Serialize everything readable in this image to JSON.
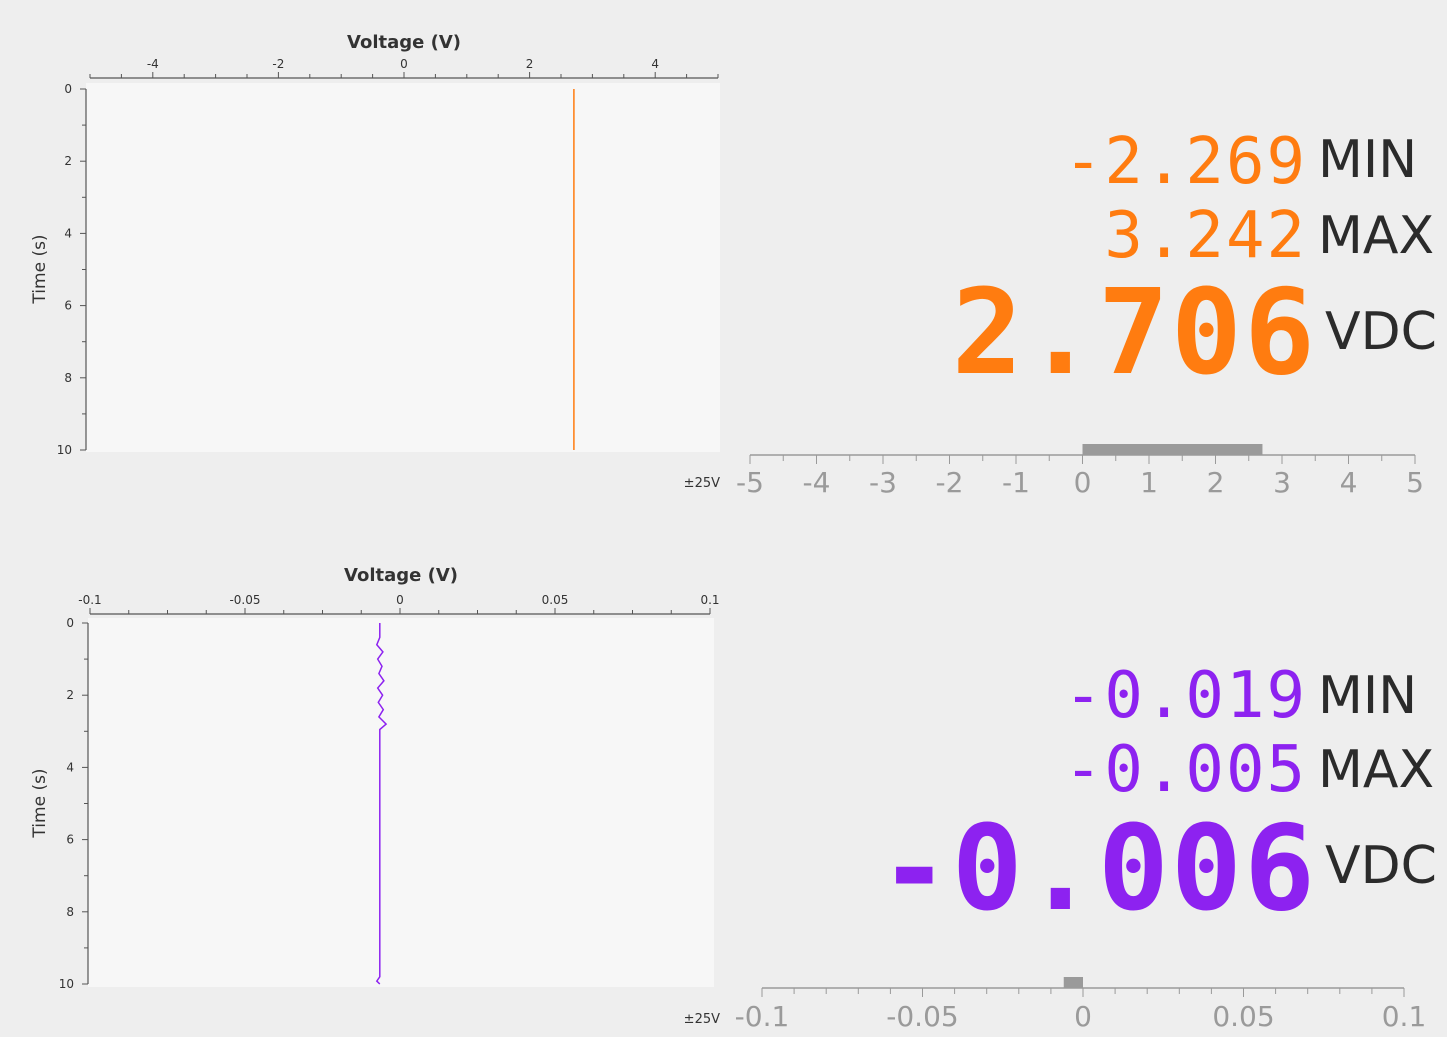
{
  "channels": [
    {
      "id": "ch1",
      "color": "#ff7c10",
      "plot": {
        "xlabel": "Voltage (V)",
        "ylabel": "Time (s)",
        "xlim": [
          -5,
          5
        ],
        "ylim": [
          0,
          10
        ],
        "x_ticks": [
          -4,
          -2,
          0,
          2,
          4
        ],
        "y_ticks": [
          0,
          2,
          4,
          6,
          8,
          10
        ],
        "trace": [
          [
            2.706,
            0
          ],
          [
            2.706,
            10
          ]
        ]
      },
      "readout": {
        "min_value": "-2.269",
        "min_label": "MIN",
        "max_value": "3.242",
        "max_label": "MAX",
        "value": "2.706",
        "unit": "VDC"
      },
      "bar": {
        "range_label": "±25V",
        "ticks": [
          "-5",
          "-4",
          "-3",
          "-2",
          "-1",
          "0",
          "1",
          "2",
          "3",
          "4",
          "5"
        ],
        "min": -5,
        "max": 5,
        "level": 2.706
      }
    },
    {
      "id": "ch2",
      "color": "#8d22f0",
      "plot": {
        "xlabel": "Voltage (V)",
        "ylabel": "Time (s)",
        "xlim": [
          -0.1,
          0.1
        ],
        "ylim": [
          0,
          10
        ],
        "x_ticks": [
          -0.1,
          -0.05,
          0,
          0.05,
          0.1
        ],
        "y_ticks": [
          0,
          2,
          4,
          6,
          8,
          10
        ],
        "trace": [
          [
            -0.0065,
            0
          ],
          [
            -0.0065,
            0.4
          ],
          [
            -0.0075,
            0.6
          ],
          [
            -0.0055,
            0.8
          ],
          [
            -0.0072,
            1.0
          ],
          [
            -0.0058,
            1.2
          ],
          [
            -0.0068,
            1.4
          ],
          [
            -0.0052,
            1.6
          ],
          [
            -0.0072,
            1.8
          ],
          [
            -0.0056,
            2.0
          ],
          [
            -0.007,
            2.2
          ],
          [
            -0.0054,
            2.4
          ],
          [
            -0.0068,
            2.6
          ],
          [
            -0.0045,
            2.8
          ],
          [
            -0.0065,
            2.95
          ],
          [
            -0.0065,
            9.8
          ],
          [
            -0.0075,
            9.92
          ],
          [
            -0.0065,
            10
          ]
        ]
      },
      "readout": {
        "min_value": "-0.019",
        "min_label": "MIN",
        "max_value": "-0.005",
        "max_label": "MAX",
        "value": "-0.006",
        "unit": "VDC"
      },
      "bar": {
        "range_label": "±25V",
        "ticks": [
          "-0.1",
          "-0.05",
          "0",
          "0.05",
          "0.1"
        ],
        "min": -0.1,
        "max": 0.1,
        "level": -0.006
      }
    }
  ]
}
